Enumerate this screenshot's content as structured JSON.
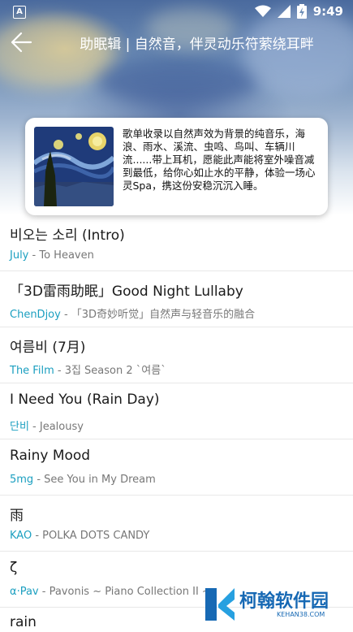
{
  "statusbar": {
    "time": "9:49",
    "left_icon": "A"
  },
  "header": {
    "back_icon": "back-arrow-icon",
    "title": "助眠辑 | 自然音，伴灵动乐符萦绕耳畔"
  },
  "playlist": {
    "description": "歌单收录以自然声效为背景的纯音乐，海浪、雨水、溪流、虫鸣、鸟叫、车辆川流......带上耳机，愿能此声能将室外噪音减到最低，给你心如止水的平静，体验一场心灵Spa，携这份安稳沉沉入睡。"
  },
  "songs": [
    {
      "title": "비오는 소리 (Intro)",
      "artist": "July",
      "album": " - To Heaven"
    },
    {
      "title": "「3D雷雨助眠」Good Night Lullaby",
      "artist": "ChenDjoy",
      "album": " - 「3D奇妙听觉」自然声与轻音乐的融合"
    },
    {
      "title": "여름비 (7月)",
      "artist": "The Film",
      "album": " - 3집 Season 2 `여름`"
    },
    {
      "title": "I Need You (Rain Day)",
      "artist": "단비",
      "album": " - Jealousy"
    },
    {
      "title": "Rainy Mood",
      "artist": "5mg",
      "album": " - See You in My Dream"
    },
    {
      "title": "雨",
      "artist": "KAO",
      "album": " - POLKA DOTS CANDY"
    },
    {
      "title": "ζ",
      "artist": "α·Pav",
      "album": " - Pavonis ~ Piano Collection II ~"
    },
    {
      "title": "rain",
      "artist": "",
      "album": ""
    }
  ],
  "watermark": {
    "text": "柯翰软件园",
    "sub": "KEHAN38.COM"
  },
  "colors": {
    "artist": "#1b9fc0",
    "watermark": "#1769b4"
  }
}
